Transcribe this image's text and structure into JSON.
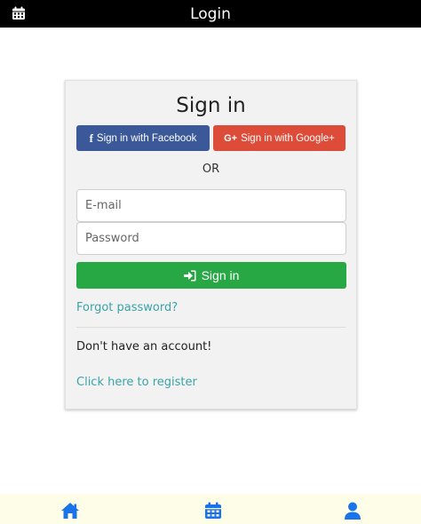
{
  "header": {
    "title": "Login"
  },
  "card": {
    "title": "Sign in",
    "facebook_label": "Sign in with Facebook",
    "google_label": "Sign in with Google+",
    "google_glyph": "G+",
    "facebook_glyph": "f",
    "or_label": "OR",
    "email_placeholder": "E-mail",
    "password_placeholder": "Password",
    "email_value": "",
    "password_value": "",
    "signin_label": "Sign in",
    "forgot_label": "Forgot password?",
    "no_account_text": "Don't have an account!",
    "register_label": "Click here to register"
  },
  "colors": {
    "facebook": "#3b5998",
    "google": "#dd4b39",
    "signin": "#28a745",
    "link": "#3aa3a8",
    "nav_icon": "#1a73e8",
    "bottom_bar": "#fefde8"
  },
  "bottom_nav": {
    "items": [
      {
        "icon": "home-icon"
      },
      {
        "icon": "calendar-icon"
      },
      {
        "icon": "user-icon"
      }
    ]
  }
}
